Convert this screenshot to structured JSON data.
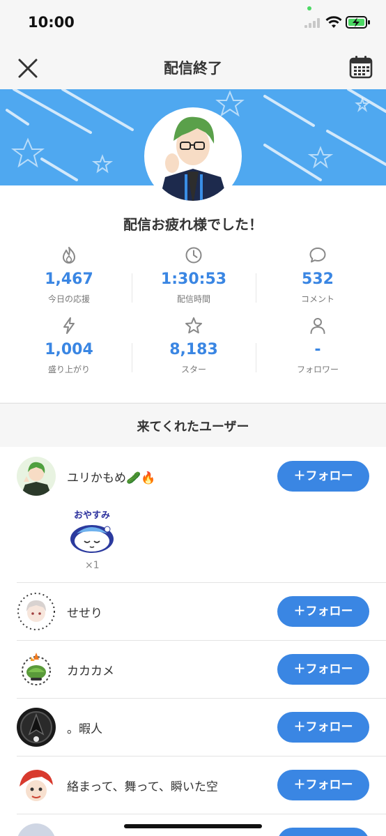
{
  "status_bar": {
    "time": "10:00"
  },
  "nav": {
    "title": "配信終了"
  },
  "summary": {
    "message": "配信お疲れ様でした！",
    "stats": [
      {
        "icon": "flame-icon",
        "value": "1,467",
        "label": "今日の応援"
      },
      {
        "icon": "clock-icon",
        "value": "1:30:53",
        "label": "配信時間"
      },
      {
        "icon": "comment-icon",
        "value": "532",
        "label": "コメント"
      },
      {
        "icon": "lightning-icon",
        "value": "1,004",
        "label": "盛り上がり"
      },
      {
        "icon": "star-icon",
        "value": "8,183",
        "label": "スター"
      },
      {
        "icon": "person-icon",
        "value": "-",
        "label": "フォロワー"
      }
    ]
  },
  "section": {
    "title": "来てくれたユーザー"
  },
  "users": [
    {
      "name": "ユリかもめ🥒🔥",
      "follow_label": "＋フォロー",
      "gift": {
        "label": "おやすみ",
        "count": "×1"
      }
    },
    {
      "name": "せせり",
      "follow_label": "＋フォロー"
    },
    {
      "name": "カカカメ",
      "follow_label": "＋フォロー"
    },
    {
      "name": "。暇人",
      "follow_label": "＋フォロー"
    },
    {
      "name": "絡まって、舞って、瞬いた空",
      "follow_label": "＋フォロー"
    }
  ],
  "colors": {
    "accent": "#3a86e3",
    "banner": "#4fa8f0"
  }
}
